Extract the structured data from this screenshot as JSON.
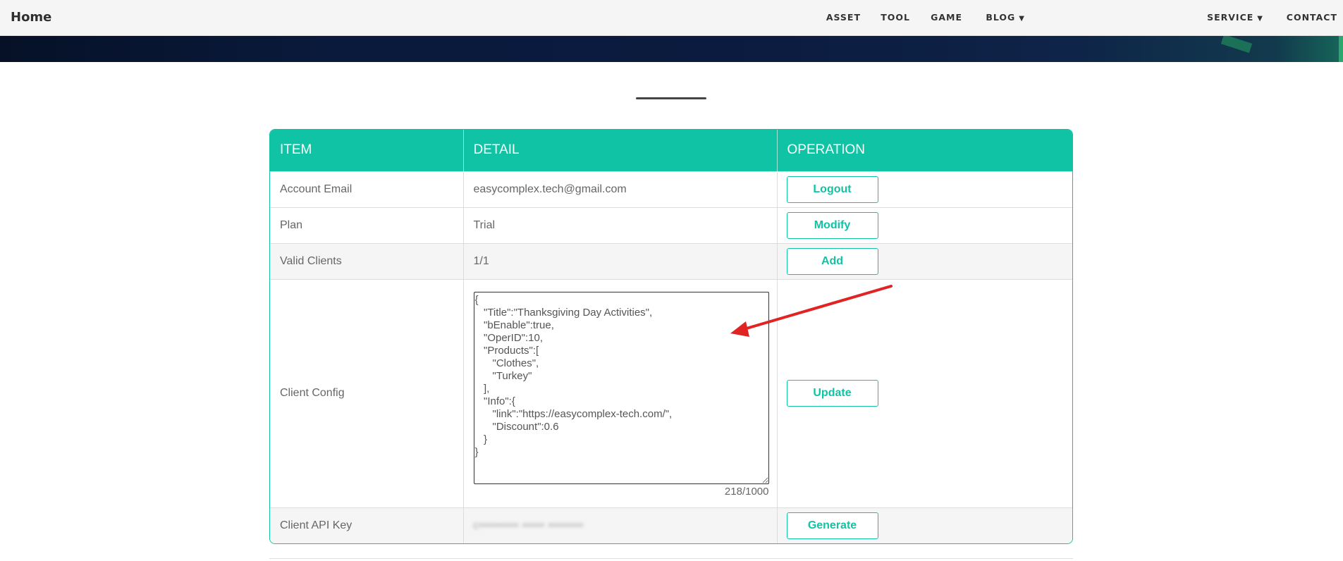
{
  "nav": {
    "brand": "Home",
    "items": [
      {
        "label": "ASSET"
      },
      {
        "label": "TOOL"
      },
      {
        "label": "GAME"
      },
      {
        "label": "BLOG",
        "caret": "▼"
      },
      {
        "label": "SERVICE",
        "caret": "▼"
      },
      {
        "label": "CONTACT"
      }
    ]
  },
  "table": {
    "headers": [
      "ITEM",
      "DETAIL",
      "OPERATION"
    ],
    "rows": [
      {
        "item": "Account Email",
        "detail": "easycomplex.tech@gmail.com",
        "operation": "Logout"
      },
      {
        "item": "Plan",
        "detail": "Trial",
        "operation": "Modify"
      },
      {
        "item": "Valid Clients",
        "detail": "1/1",
        "operation": "Add"
      },
      {
        "item": "Client Config",
        "config": "{\n   \"Title\":\"Thanksgiving Day Activities\",\n   \"bEnable\":true,\n   \"OperID\":10,\n   \"Products\":[\n      \"Clothes\",\n      \"Turkey\"\n   ],\n   \"Info\":{\n      \"link\":\"https://easycomplex-tech.com/\",\n      \"Discount\":0.6\n   }\n}",
        "counter": "218/1000",
        "operation": "Update"
      },
      {
        "item": "Client API Key",
        "detail": "c••••••••• ••••• ••••••••",
        "operation": "Generate"
      }
    ]
  },
  "colors": {
    "accent": "#10c3a4",
    "annotation_arrow": "#e02424",
    "banner": "#0b1b3f"
  }
}
